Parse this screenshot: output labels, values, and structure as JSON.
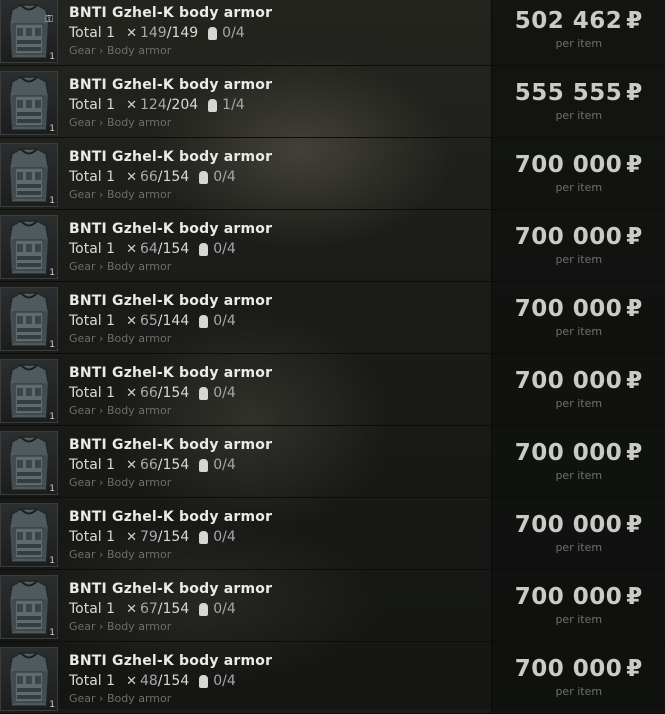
{
  "offers": [
    {
      "name": "BNTI Gzhel-K body armor",
      "total_label": "Total 1",
      "durability_current": "149",
      "durability_max": "149",
      "plates": "0/4",
      "category": "Gear › Body armor",
      "price": "502 462",
      "currency": "₽",
      "per_item": "per item",
      "stack_count": "1",
      "locked": true
    },
    {
      "name": "BNTI Gzhel-K body armor",
      "total_label": "Total 1",
      "durability_current": "124",
      "durability_max": "204",
      "plates": "1/4",
      "category": "Gear › Body armor",
      "price": "555 555",
      "currency": "₽",
      "per_item": "per item",
      "stack_count": "1",
      "locked": false
    },
    {
      "name": "BNTI Gzhel-K body armor",
      "total_label": "Total 1",
      "durability_current": "66",
      "durability_max": "154",
      "plates": "0/4",
      "category": "Gear › Body armor",
      "price": "700 000",
      "currency": "₽",
      "per_item": "per item",
      "stack_count": "1",
      "locked": false
    },
    {
      "name": "BNTI Gzhel-K body armor",
      "total_label": "Total 1",
      "durability_current": "64",
      "durability_max": "154",
      "plates": "0/4",
      "category": "Gear › Body armor",
      "price": "700 000",
      "currency": "₽",
      "per_item": "per item",
      "stack_count": "1",
      "locked": false
    },
    {
      "name": "BNTI Gzhel-K body armor",
      "total_label": "Total 1",
      "durability_current": "65",
      "durability_max": "144",
      "plates": "0/4",
      "category": "Gear › Body armor",
      "price": "700 000",
      "currency": "₽",
      "per_item": "per item",
      "stack_count": "1",
      "locked": false
    },
    {
      "name": "BNTI Gzhel-K body armor",
      "total_label": "Total 1",
      "durability_current": "66",
      "durability_max": "154",
      "plates": "0/4",
      "category": "Gear › Body armor",
      "price": "700 000",
      "currency": "₽",
      "per_item": "per item",
      "stack_count": "1",
      "locked": false
    },
    {
      "name": "BNTI Gzhel-K body armor",
      "total_label": "Total 1",
      "durability_current": "66",
      "durability_max": "154",
      "plates": "0/4",
      "category": "Gear › Body armor",
      "price": "700 000",
      "currency": "₽",
      "per_item": "per item",
      "stack_count": "1",
      "locked": false
    },
    {
      "name": "BNTI Gzhel-K body armor",
      "total_label": "Total 1",
      "durability_current": "79",
      "durability_max": "154",
      "plates": "0/4",
      "category": "Gear › Body armor",
      "price": "700 000",
      "currency": "₽",
      "per_item": "per item",
      "stack_count": "1",
      "locked": false
    },
    {
      "name": "BNTI Gzhel-K body armor",
      "total_label": "Total 1",
      "durability_current": "67",
      "durability_max": "154",
      "plates": "0/4",
      "category": "Gear › Body armor",
      "price": "700 000",
      "currency": "₽",
      "per_item": "per item",
      "stack_count": "1",
      "locked": false
    },
    {
      "name": "BNTI Gzhel-K body armor",
      "total_label": "Total 1",
      "durability_current": "48",
      "durability_max": "154",
      "plates": "0/4",
      "category": "Gear › Body armor",
      "price": "700 000",
      "currency": "₽",
      "per_item": "per item",
      "stack_count": "1",
      "locked": false
    }
  ],
  "icons": {
    "durability": "crossed-tools-icon",
    "plates": "armor-plate-icon",
    "lock": "locked-item-icon"
  },
  "colors": {
    "row_divider": "#0b0c0b",
    "price_text": "#c9cbc5",
    "name_text": "#e9ebe8",
    "muted_text": "#6b6e69"
  }
}
